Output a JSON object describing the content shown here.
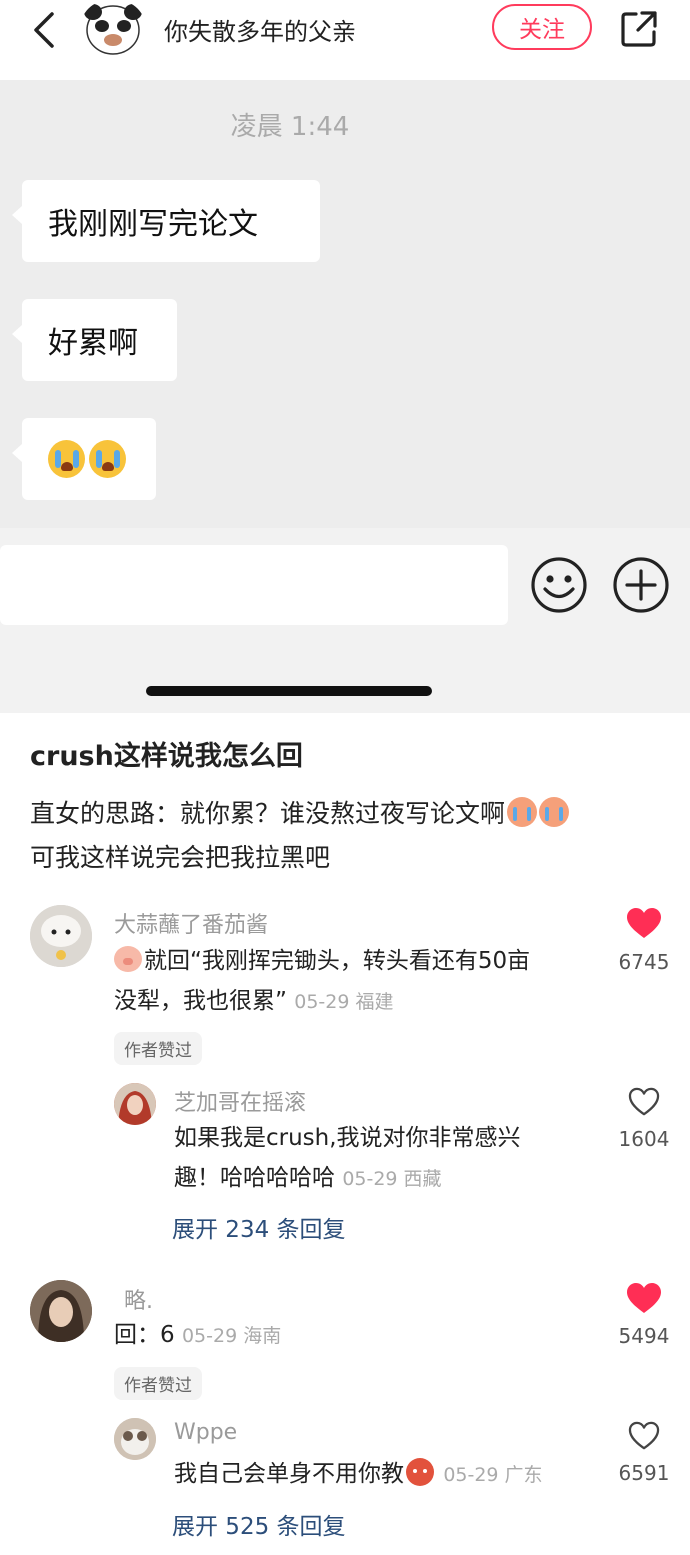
{
  "chat": {
    "contact_name": "你失散多年的父亲",
    "follow_label": "关注",
    "timestamp": "凌晨 1:44",
    "messages": [
      {
        "text": "我刚刚写完论文"
      },
      {
        "text": "好累啊"
      },
      {
        "text": "",
        "emojis": [
          "loudly-crying-face-emoji",
          "loudly-crying-face-emoji"
        ]
      }
    ]
  },
  "post": {
    "title": "crush这样说我怎么回",
    "body_line1": "直女的思路：就你累？谁没熬过夜写论文啊",
    "body_line2": "可我这样说完会把我拉黑吧"
  },
  "comments": [
    {
      "username": "大蒜蘸了番茄酱",
      "text_line1": "就回“我刚挥完锄头，转头看还有50亩",
      "text_line2": "没犁，我也很累”",
      "meta": "05-29 福建",
      "badge": "作者赞过",
      "likes": "6745",
      "liked": true,
      "reply": {
        "username": "芝加哥在摇滚",
        "text_line1": "如果我是crush,我说对你非常感兴",
        "text_line2": "趣！哈哈哈哈哈",
        "meta": "05-29 西藏",
        "likes": "1604",
        "liked": false
      },
      "expand": "展开 234 条回复"
    },
    {
      "username": "略.",
      "text": "回：6",
      "meta": "05-29 海南",
      "badge": "作者赞过",
      "likes": "5494",
      "liked": true,
      "reply": {
        "username": "Wppe",
        "text": "我自己会单身不用你教",
        "meta": "05-29 广东",
        "likes": "6591",
        "liked": false
      },
      "expand": "展开 525 条回复"
    }
  ],
  "colors": {
    "accent": "#ff3b5c",
    "chat_bg": "#ededed",
    "link": "#2c4e7a"
  }
}
